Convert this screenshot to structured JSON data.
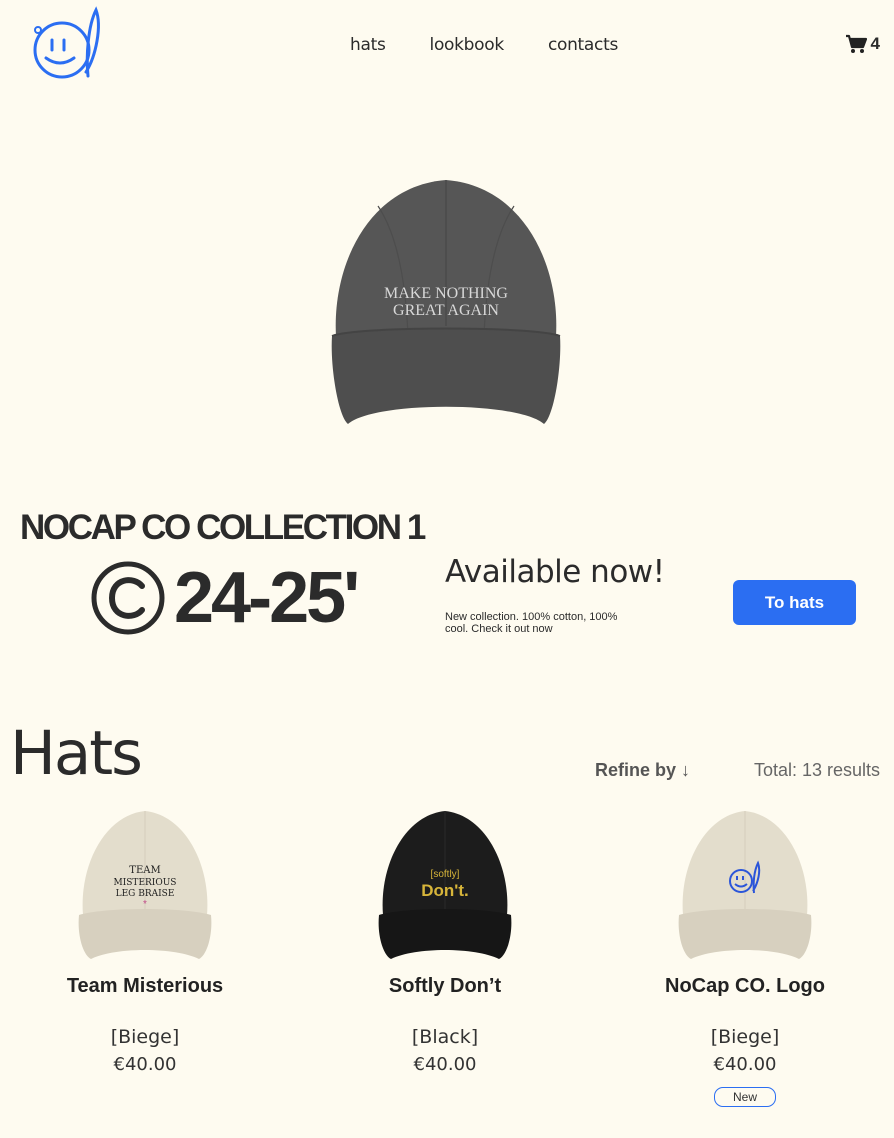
{
  "header": {
    "nav": [
      "hats",
      "lookbook",
      "contacts"
    ],
    "cart_count": "4"
  },
  "hero": {
    "cap_text_line1": "MAKE NOTHING",
    "cap_text_line2": "GREAT AGAIN"
  },
  "collection": {
    "title": "NOCAP CO COLLECTION 1",
    "year": "24-25'",
    "available": "Available now!",
    "description": "New collection. 100% cotton, 100% cool. Check it out now",
    "button": "To hats"
  },
  "hats": {
    "heading": "Hats",
    "refine": "Refine by ↓",
    "total": "Total: 13 results",
    "products": [
      {
        "name": "Team Misterious",
        "variant": "[Biege]",
        "price": "€40.00",
        "cap_color": "#e2dccb",
        "print": [
          "TEAM",
          "MISTERIOUS",
          "LEG BRAISE"
        ]
      },
      {
        "name": "Softly Don’t",
        "variant": "[Black]",
        "price": "€40.00",
        "cap_color": "#1e1e1e",
        "print": [
          "[softly]",
          "Don't."
        ]
      },
      {
        "name": "NoCap CO. Logo",
        "variant": "[Biege]",
        "price": "€40.00",
        "cap_color": "#e2dccb",
        "badge": "New"
      }
    ]
  },
  "colors": {
    "accent": "#2b6ef2",
    "background": "#fefbf0",
    "text": "#2b2b2b"
  }
}
